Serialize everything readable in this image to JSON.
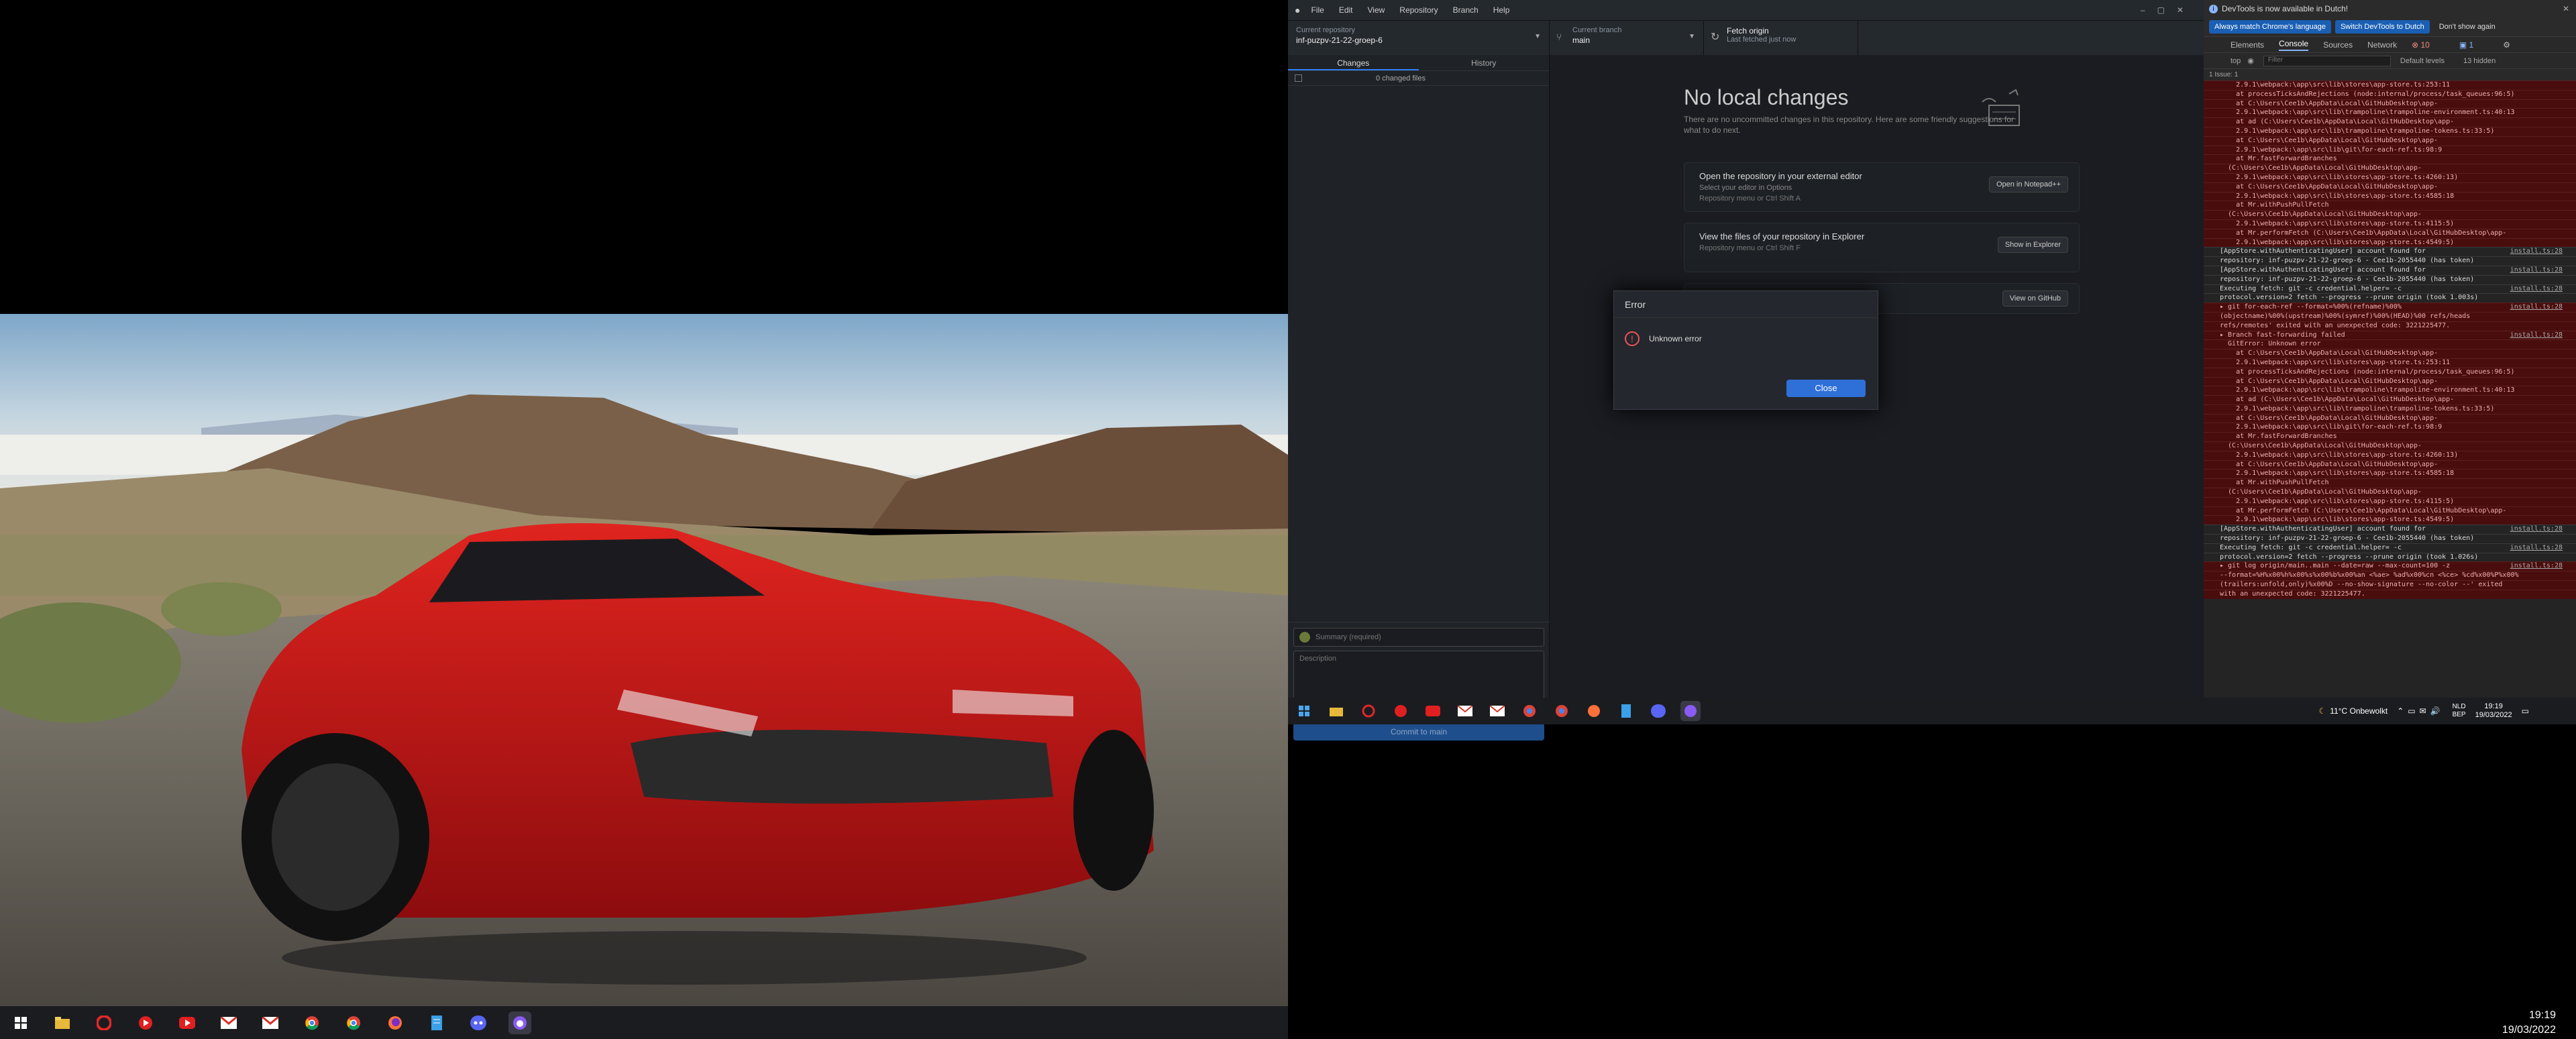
{
  "left": {
    "clock": {
      "time": "19:19",
      "date": "19/03/2022"
    },
    "taskbar_icons": [
      "windows-icon",
      "file-explorer-icon",
      "opera-icon",
      "youtube-music-icon",
      "youtube-icon",
      "gmail-icon",
      "gmail-icon",
      "chrome-icon",
      "chrome-icon",
      "firefox-icon",
      "notepad-icon",
      "discord-icon",
      "github-desktop-icon"
    ]
  },
  "gh": {
    "menu": [
      "File",
      "Edit",
      "View",
      "Repository",
      "Branch",
      "Help"
    ],
    "repo_label": "Current repository",
    "repo_value": "inf-puzpv-21-22-groep-6",
    "branch_label": "Current branch",
    "branch_value": "main",
    "fetch_label": "Fetch origin",
    "fetch_sub": "Last fetched just now",
    "tab_changes": "Changes",
    "tab_history": "History",
    "changed_files": "0 changed files",
    "summary_placeholder": "Summary (required)",
    "description_placeholder": "Description",
    "commit_button": "Commit to main",
    "no_changes_title": "No local changes",
    "no_changes_sub": "There are no uncommitted changes in this repository. Here are some friendly suggestions for what to do next.",
    "s1_title": "Open the repository in your external editor",
    "s1_desc": "Select your editor in Options",
    "s1_keys": "Repository menu or Ctrl Shift A",
    "s1_btn": "Open in Notepad++",
    "s2_title": "View the files of your repository in Explorer",
    "s2_keys": "Repository menu or Ctrl Shift F",
    "s2_btn": "Show in Explorer",
    "s3_btn": "View on GitHub"
  },
  "dialog": {
    "title": "Error",
    "message": "Unknown error",
    "close": "Close"
  },
  "devtools": {
    "info": "DevTools is now available in Dutch!",
    "btn1": "Always match Chrome's language",
    "btn2": "Switch DevTools to Dutch",
    "btn3": "Don't show again",
    "tabs": [
      "Elements",
      "Console",
      "Sources",
      "Network"
    ],
    "err_count": "10",
    "info_count": "1",
    "top": "top",
    "filter": "Filter",
    "levels": "Default levels",
    "hidden": "13 hidden",
    "issues": "1 Issue: 1",
    "lines": [
      {
        "k": "err",
        "t": "    2.9.1\\webpack:\\app\\src\\lib\\stores\\app-store.ts:253:11",
        "s": ""
      },
      {
        "k": "err",
        "t": "    at processTicksAndRejections (node:internal/process/task_queues:96:5)",
        "s": ""
      },
      {
        "k": "err",
        "t": "    at C:\\Users\\Cee1b\\AppData\\Local\\GitHubDesktop\\app-",
        "s": ""
      },
      {
        "k": "err",
        "t": "    2.9.1\\webpack:\\app\\src\\lib\\trampoline\\trampoline-environment.ts:40:13",
        "s": ""
      },
      {
        "k": "err",
        "t": "    at ad (C:\\Users\\Cee1b\\AppData\\Local\\GitHubDesktop\\app-",
        "s": ""
      },
      {
        "k": "err",
        "t": "    2.9.1\\webpack:\\app\\src\\lib\\trampoline\\trampoline-tokens.ts:33:5)",
        "s": ""
      },
      {
        "k": "err",
        "t": "    at C:\\Users\\Cee1b\\AppData\\Local\\GitHubDesktop\\app-",
        "s": ""
      },
      {
        "k": "err",
        "t": "    2.9.1\\webpack:\\app\\src\\lib\\git\\for-each-ref.ts:98:9",
        "s": ""
      },
      {
        "k": "err",
        "t": "    at Mr.fastForwardBranches",
        "s": ""
      },
      {
        "k": "err",
        "t": "  (C:\\Users\\Cee1b\\AppData\\Local\\GitHubDesktop\\app-",
        "s": ""
      },
      {
        "k": "err",
        "t": "    2.9.1\\webpack:\\app\\src\\lib\\stores\\app-store.ts:4260:13)",
        "s": ""
      },
      {
        "k": "err",
        "t": "    at C:\\Users\\Cee1b\\AppData\\Local\\GitHubDesktop\\app-",
        "s": ""
      },
      {
        "k": "err",
        "t": "    2.9.1\\webpack:\\app\\src\\lib\\stores\\app-store.ts:4585:18",
        "s": ""
      },
      {
        "k": "err",
        "t": "    at Mr.withPushPullFetch",
        "s": ""
      },
      {
        "k": "err",
        "t": "  (C:\\Users\\Cee1b\\AppData\\Local\\GitHubDesktop\\app-",
        "s": ""
      },
      {
        "k": "err",
        "t": "    2.9.1\\webpack:\\app\\src\\lib\\stores\\app-store.ts:4115:5)",
        "s": ""
      },
      {
        "k": "err",
        "t": "    at Mr.performFetch (C:\\Users\\Cee1b\\AppData\\Local\\GitHubDesktop\\app-",
        "s": ""
      },
      {
        "k": "err",
        "t": "    2.9.1\\webpack:\\app\\src\\lib\\stores\\app-store.ts:4549:5)",
        "s": ""
      },
      {
        "k": "info",
        "t": "[AppStore.withAuthenticatingUser] account found for",
        "s": "install.ts:28"
      },
      {
        "k": "info",
        "t": "repository: inf-puzpv-21-22-groep-6 - Cee1b-2055440 (has token)",
        "s": ""
      },
      {
        "k": "info",
        "t": "[AppStore.withAuthenticatingUser] account found for",
        "s": "install.ts:28"
      },
      {
        "k": "info",
        "t": "repository: inf-puzpv-21-22-groep-6 - Cee1b-2055440 (has token)",
        "s": ""
      },
      {
        "k": "info",
        "t": "Executing fetch: git -c credential.helper= -c",
        "s": "install.ts:28"
      },
      {
        "k": "info",
        "t": "protocol.version=2 fetch --progress --prune origin (took 1.003s)",
        "s": ""
      },
      {
        "k": "err",
        "t": "▸ git for-each-ref --format=%00%(refname)%00%",
        "s": "install.ts:28"
      },
      {
        "k": "err",
        "t": "(objectname)%00%(upstream)%00%(symref)%00%(HEAD)%00 refs/heads",
        "s": ""
      },
      {
        "k": "err",
        "t": "refs/remotes' exited with an unexpected code: 3221225477.",
        "s": ""
      },
      {
        "k": "err",
        "t": "▸ Branch fast-forwarding failed",
        "s": "install.ts:28"
      },
      {
        "k": "err",
        "t": "  GitError: Unknown error",
        "s": ""
      },
      {
        "k": "err",
        "t": "    at C:\\Users\\Cee1b\\AppData\\Local\\GitHubDesktop\\app-",
        "s": ""
      },
      {
        "k": "err",
        "t": "    2.9.1\\webpack:\\app\\src\\lib\\stores\\app-store.ts:253:11",
        "s": ""
      },
      {
        "k": "err",
        "t": "    at processTicksAndRejections (node:internal/process/task_queues:96:5)",
        "s": ""
      },
      {
        "k": "err",
        "t": "    at C:\\Users\\Cee1b\\AppData\\Local\\GitHubDesktop\\app-",
        "s": ""
      },
      {
        "k": "err",
        "t": "    2.9.1\\webpack:\\app\\src\\lib\\trampoline\\trampoline-environment.ts:40:13",
        "s": ""
      },
      {
        "k": "err",
        "t": "    at ad (C:\\Users\\Cee1b\\AppData\\Local\\GitHubDesktop\\app-",
        "s": ""
      },
      {
        "k": "err",
        "t": "    2.9.1\\webpack:\\app\\src\\lib\\trampoline\\trampoline-tokens.ts:33:5)",
        "s": ""
      },
      {
        "k": "err",
        "t": "    at C:\\Users\\Cee1b\\AppData\\Local\\GitHubDesktop\\app-",
        "s": ""
      },
      {
        "k": "err",
        "t": "    2.9.1\\webpack:\\app\\src\\lib\\git\\for-each-ref.ts:98:9",
        "s": ""
      },
      {
        "k": "err",
        "t": "    at Mr.fastForwardBranches",
        "s": ""
      },
      {
        "k": "err",
        "t": "  (C:\\Users\\Cee1b\\AppData\\Local\\GitHubDesktop\\app-",
        "s": ""
      },
      {
        "k": "err",
        "t": "    2.9.1\\webpack:\\app\\src\\lib\\stores\\app-store.ts:4260:13)",
        "s": ""
      },
      {
        "k": "err",
        "t": "    at C:\\Users\\Cee1b\\AppData\\Local\\GitHubDesktop\\app-",
        "s": ""
      },
      {
        "k": "err",
        "t": "    2.9.1\\webpack:\\app\\src\\lib\\stores\\app-store.ts:4585:18",
        "s": ""
      },
      {
        "k": "err",
        "t": "    at Mr.withPushPullFetch",
        "s": ""
      },
      {
        "k": "err",
        "t": "  (C:\\Users\\Cee1b\\AppData\\Local\\GitHubDesktop\\app-",
        "s": ""
      },
      {
        "k": "err",
        "t": "    2.9.1\\webpack:\\app\\src\\lib\\stores\\app-store.ts:4115:5)",
        "s": ""
      },
      {
        "k": "err",
        "t": "    at Mr.performFetch (C:\\Users\\Cee1b\\AppData\\Local\\GitHubDesktop\\app-",
        "s": ""
      },
      {
        "k": "err",
        "t": "    2.9.1\\webpack:\\app\\src\\lib\\stores\\app-store.ts:4549:5)",
        "s": ""
      },
      {
        "k": "info",
        "t": "[AppStore.withAuthenticatingUser] account found for",
        "s": "install.ts:28"
      },
      {
        "k": "info",
        "t": "repository: inf-puzpv-21-22-groep-6 - Cee1b-2055440 (has token)",
        "s": ""
      },
      {
        "k": "info",
        "t": "Executing fetch: git -c credential.helper= -c",
        "s": "install.ts:28"
      },
      {
        "k": "info",
        "t": "protocol.version=2 fetch --progress --prune origin (took 1.026s)",
        "s": ""
      },
      {
        "k": "err",
        "t": "▸ git log origin/main..main --date=raw --max-count=100 -z",
        "s": "install.ts:28"
      },
      {
        "k": "err",
        "t": "--format=%H%x00%h%x00%s%x00%b%x00%an <%ae> %ad%x00%cn <%ce> %cd%x00%P%x00%",
        "s": ""
      },
      {
        "k": "err",
        "t": "(trailers:unfold,only)%x00%D --no-show-signature --no-color --' exited",
        "s": ""
      },
      {
        "k": "err",
        "t": "with an unexpected code: 3221225477.",
        "s": ""
      }
    ]
  },
  "rtray": {
    "weather": "11°C  Onbewolkt",
    "lang1": "NLD",
    "lang2": "BEP",
    "time": "19:19",
    "date": "19/03/2022"
  },
  "colors": {
    "accent": "#2f81f7",
    "error_bg": "#4a0d0d",
    "car_red": "#c8151b"
  }
}
